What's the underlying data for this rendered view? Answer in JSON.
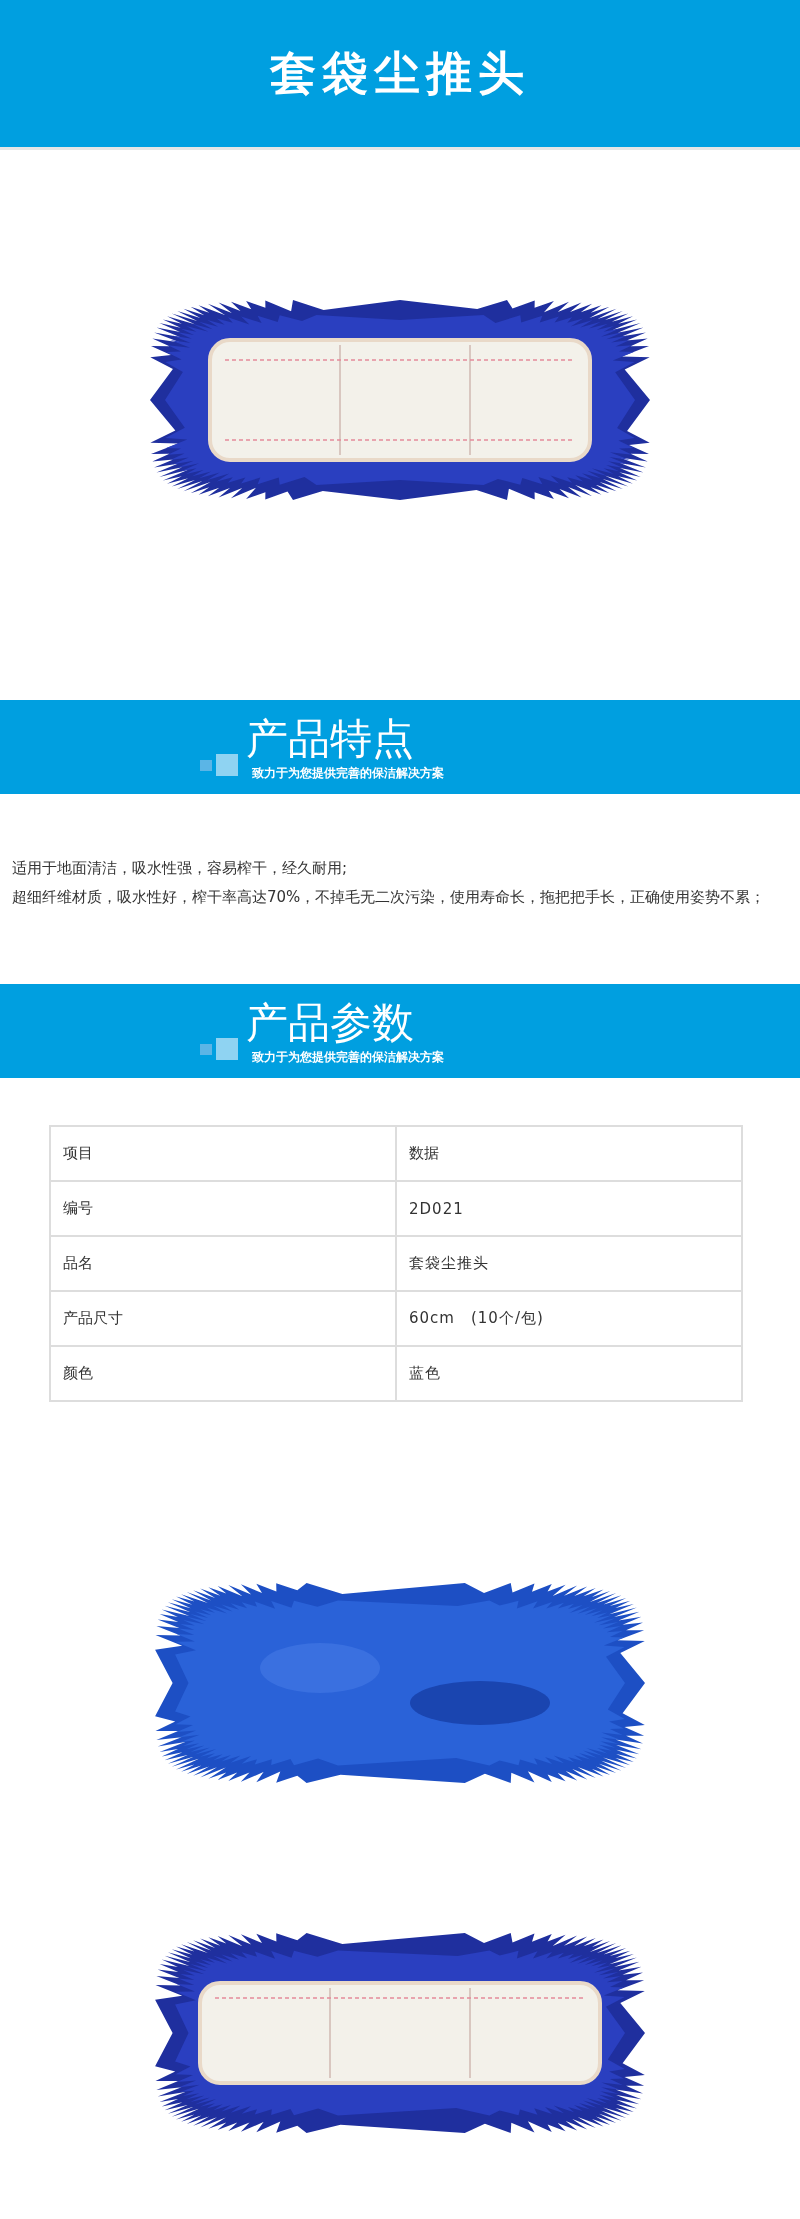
{
  "title": "套袋尘推头",
  "hero": {
    "kind": "picture"
  },
  "sections": [
    {
      "title": "产品特点",
      "subtitle": "致力于为您提供完善的保洁解决方案"
    },
    {
      "title": "产品参数",
      "subtitle": "致力于为您提供完善的保洁解决方案"
    }
  ],
  "features": [
    "适用于地面清洁，吸水性强，容易榨干，经久耐用;",
    "超细纤维材质，吸水性好，榨干率高达70%，不掉毛无二次污染，使用寿命长，拖把把手长，正确使用姿势不累；"
  ],
  "table": {
    "columns": [
      "项目",
      "数据"
    ],
    "rows": [
      [
        "编号",
        "2D021"
      ],
      [
        "品名",
        "套袋尘推头"
      ],
      [
        "产品尺寸",
        "60cm　(10个/包)"
      ],
      [
        "颜色",
        "蓝色"
      ]
    ]
  },
  "gallery": [
    {
      "kind": "picture"
    },
    {
      "kind": "picture"
    }
  ]
}
